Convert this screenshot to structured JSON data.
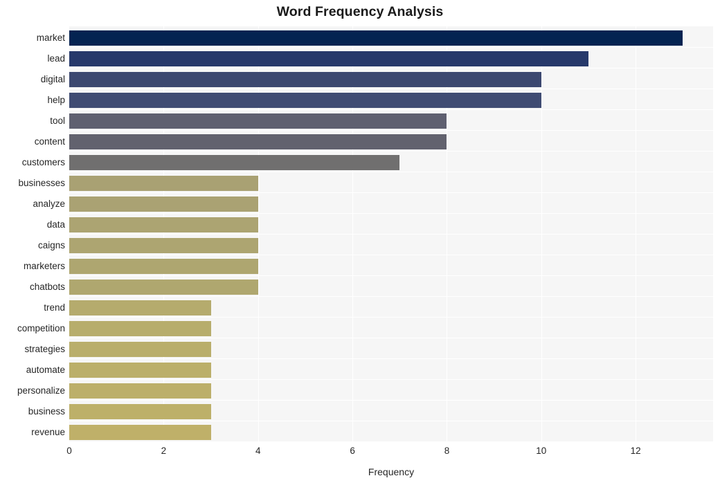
{
  "chart_data": {
    "type": "bar",
    "orientation": "horizontal",
    "title": "Word Frequency Analysis",
    "xlabel": "Frequency",
    "ylabel": "",
    "xlim": [
      0,
      13.64
    ],
    "xticks": [
      0,
      2,
      4,
      6,
      8,
      10,
      12
    ],
    "grid": true,
    "legend": null,
    "categories": [
      "market",
      "lead",
      "digital",
      "help",
      "tool",
      "content",
      "customers",
      "businesses",
      "analyze",
      "data",
      "caigns",
      "marketers",
      "chatbots",
      "trend",
      "competition",
      "strategies",
      "automate",
      "personalize",
      "business",
      "revenue"
    ],
    "values": [
      13,
      11,
      10,
      10,
      8,
      8,
      7,
      4,
      4,
      4,
      4,
      4,
      3,
      3,
      3,
      3,
      3,
      3,
      3
    ],
    "bars": [
      {
        "label": "market",
        "value": 13,
        "color": "#042351"
      },
      {
        "label": "lead",
        "value": 11,
        "color": "#27396b"
      },
      {
        "label": "digital",
        "value": 10,
        "color": "#3c4870"
      },
      {
        "label": "help",
        "value": 10,
        "color": "#404c73"
      },
      {
        "label": "tool",
        "value": 8,
        "color": "#5f6070"
      },
      {
        "label": "content",
        "value": 8,
        "color": "#62626e"
      },
      {
        "label": "customers",
        "value": 7,
        "color": "#706f6f"
      },
      {
        "label": "businesses",
        "value": 4,
        "color": "#a9a173"
      },
      {
        "label": "analyze",
        "value": 4,
        "color": "#aaa273"
      },
      {
        "label": "data",
        "value": 4,
        "color": "#aca472"
      },
      {
        "label": "caigns",
        "value": 4,
        "color": "#ada571"
      },
      {
        "label": "marketers",
        "value": 4,
        "color": "#aea670"
      },
      {
        "label": "chatbots",
        "value": 4,
        "color": "#afa76f"
      },
      {
        "label": "trend",
        "value": 3,
        "color": "#b5ab6d"
      },
      {
        "label": "competition",
        "value": 3,
        "color": "#b7ad6c"
      },
      {
        "label": "strategies",
        "value": 3,
        "color": "#b9ae6b"
      },
      {
        "label": "automate",
        "value": 3,
        "color": "#bbaf6a"
      },
      {
        "label": "personalize",
        "value": 3,
        "color": "#bcaf6a"
      },
      {
        "label": "business",
        "value": 3,
        "color": "#bdb069"
      },
      {
        "label": "revenue",
        "value": 3,
        "color": "#bfb069"
      }
    ],
    "colors": {
      "plot_background": "#f6f6f6",
      "figure_background": "#ffffff",
      "gridline": "#ffffff",
      "tick_label": "#262626",
      "title": "#1a1a1a"
    }
  }
}
